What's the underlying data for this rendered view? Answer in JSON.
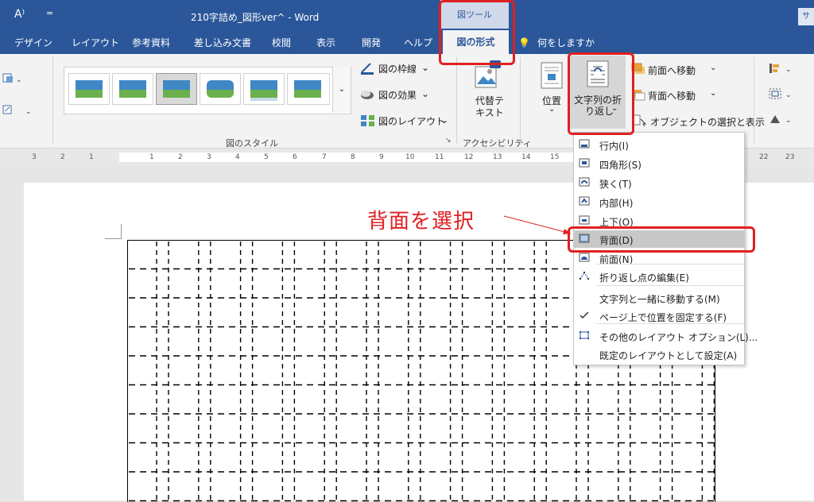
{
  "titlebar": {
    "app_icon": "A⁾",
    "qat_dropdown": "=",
    "title": "210字詰め_図形ver^ - Word",
    "tool_group": "図ツール",
    "right_stub": "サ"
  },
  "tabs": [
    "デザイン",
    "レイアウト",
    "参考資料",
    "差し込み文書",
    "校閲",
    "表示",
    "開発",
    "ヘルプ"
  ],
  "active_tab": "図の形式",
  "tell_me": "何をしますか",
  "ribbon": {
    "picture_styles_label": "図のスタイル",
    "border_btn": "図の枠線",
    "effects_btn": "図の効果",
    "layout_btn": "図のレイアウト",
    "alt_text_btn": "代替テ\nキスト",
    "accessibility_label": "アクセシビリティ",
    "position_btn": "位置",
    "wrap_btn_line1": "文字列の折",
    "wrap_btn_line2": "り返し",
    "bring_forward": "前面へ移動",
    "send_backward": "背面へ移動",
    "selection_pane": "オブジェクトの選択と表示"
  },
  "ruler_numbers": [
    "3",
    "2",
    "1",
    "1",
    "2",
    "3",
    "4",
    "5",
    "6",
    "7",
    "8",
    "9",
    "10",
    "11",
    "12",
    "13",
    "14",
    "15",
    "22",
    "23"
  ],
  "menu": {
    "items": [
      {
        "label": "行内(I)",
        "icon": "inline-icon"
      },
      {
        "label": "四角形(S)",
        "icon": "square-icon"
      },
      {
        "label": "狭く(T)",
        "icon": "tight-icon"
      },
      {
        "label": "内部(H)",
        "icon": "through-icon"
      },
      {
        "label": "上下(O)",
        "icon": "top-bottom-icon"
      },
      {
        "label": "背面(D)",
        "icon": "behind-text-icon"
      },
      {
        "label": "前面(N)",
        "icon": "in-front-icon"
      },
      {
        "label": "折り返し点の編集(E)",
        "icon": "edit-wrap-points-icon"
      },
      {
        "label": "文字列と一緒に移動する(M)",
        "icon": ""
      },
      {
        "label": "ページ上で位置を固定する(F)",
        "icon": "check-icon"
      },
      {
        "label": "その他のレイアウト オプション(L)...",
        "icon": "layout-options-icon"
      },
      {
        "label": "既定のレイアウトとして設定(A)",
        "icon": ""
      }
    ]
  },
  "annotation": "背面を選択",
  "colors": {
    "title_bar": "#2b579a",
    "highlight_red": "#e02020",
    "menu_highlight": "#c8c8c8"
  }
}
